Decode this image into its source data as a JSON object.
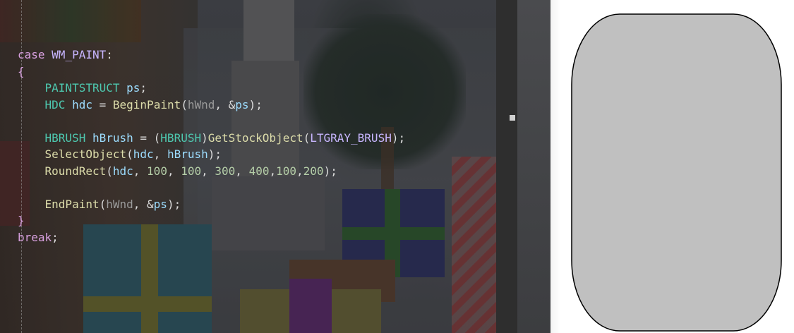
{
  "editor": {
    "code_lines": [
      [
        {
          "t": "case ",
          "c": "kw"
        },
        {
          "t": "WM_PAINT",
          "c": "macro"
        },
        {
          "t": ":",
          "c": "punct"
        }
      ],
      [
        {
          "t": "{",
          "c": "kw"
        }
      ],
      [
        {
          "t": "    ",
          "c": "punct"
        },
        {
          "t": "PAINTSTRUCT",
          "c": "type"
        },
        {
          "t": " ",
          "c": "punct"
        },
        {
          "t": "ps",
          "c": "var"
        },
        {
          "t": ";",
          "c": "punct"
        }
      ],
      [
        {
          "t": "    ",
          "c": "punct"
        },
        {
          "t": "HDC",
          "c": "type"
        },
        {
          "t": " ",
          "c": "punct"
        },
        {
          "t": "hdc",
          "c": "var"
        },
        {
          "t": " = ",
          "c": "punct"
        },
        {
          "t": "BeginPaint",
          "c": "fn"
        },
        {
          "t": "(",
          "c": "punct"
        },
        {
          "t": "hWnd",
          "c": "param"
        },
        {
          "t": ", &",
          "c": "punct"
        },
        {
          "t": "ps",
          "c": "var"
        },
        {
          "t": ");",
          "c": "punct"
        }
      ],
      [],
      [
        {
          "t": "    ",
          "c": "punct"
        },
        {
          "t": "HBRUSH",
          "c": "type"
        },
        {
          "t": " ",
          "c": "punct"
        },
        {
          "t": "hBrush",
          "c": "var"
        },
        {
          "t": " = (",
          "c": "punct"
        },
        {
          "t": "HBRUSH",
          "c": "type"
        },
        {
          "t": ")",
          "c": "punct"
        },
        {
          "t": "GetStockObject",
          "c": "fn"
        },
        {
          "t": "(",
          "c": "punct"
        },
        {
          "t": "LTGRAY_BRUSH",
          "c": "macro"
        },
        {
          "t": ");",
          "c": "punct"
        }
      ],
      [
        {
          "t": "    ",
          "c": "punct"
        },
        {
          "t": "SelectObject",
          "c": "fn"
        },
        {
          "t": "(",
          "c": "punct"
        },
        {
          "t": "hdc",
          "c": "var"
        },
        {
          "t": ", ",
          "c": "punct"
        },
        {
          "t": "hBrush",
          "c": "var"
        },
        {
          "t": ");",
          "c": "punct"
        }
      ],
      [
        {
          "t": "    ",
          "c": "punct"
        },
        {
          "t": "RoundRect",
          "c": "fn"
        },
        {
          "t": "(",
          "c": "punct"
        },
        {
          "t": "hdc",
          "c": "var"
        },
        {
          "t": ", ",
          "c": "punct"
        },
        {
          "t": "100",
          "c": "num"
        },
        {
          "t": ", ",
          "c": "punct"
        },
        {
          "t": "100",
          "c": "num"
        },
        {
          "t": ", ",
          "c": "punct"
        },
        {
          "t": "300",
          "c": "num"
        },
        {
          "t": ", ",
          "c": "punct"
        },
        {
          "t": "400",
          "c": "num"
        },
        {
          "t": ",",
          "c": "punct"
        },
        {
          "t": "100",
          "c": "num"
        },
        {
          "t": ",",
          "c": "punct"
        },
        {
          "t": "200",
          "c": "num"
        },
        {
          "t": ");",
          "c": "punct"
        }
      ],
      [],
      [
        {
          "t": "    ",
          "c": "punct"
        },
        {
          "t": "EndPaint",
          "c": "fn"
        },
        {
          "t": "(",
          "c": "punct"
        },
        {
          "t": "hWnd",
          "c": "param"
        },
        {
          "t": ", &",
          "c": "punct"
        },
        {
          "t": "ps",
          "c": "var"
        },
        {
          "t": ");",
          "c": "punct"
        }
      ],
      [
        {
          "t": "}",
          "c": "kw"
        }
      ],
      [
        {
          "t": "break",
          "c": "kw"
        },
        {
          "t": ";",
          "c": "punct"
        }
      ]
    ]
  },
  "output_window": {
    "shape": "rounded-rectangle",
    "fill_color": "#c0c0c0",
    "border_color": "#000000",
    "background_color": "#ffffff"
  },
  "colors": {
    "keyword": "#d8a0df",
    "macro": "#c8b6ff",
    "type": "#4ec9b0",
    "variable": "#9cdcfe",
    "function": "#dcdcaa",
    "parameter": "#9a9a9a",
    "number": "#b5cea8"
  }
}
